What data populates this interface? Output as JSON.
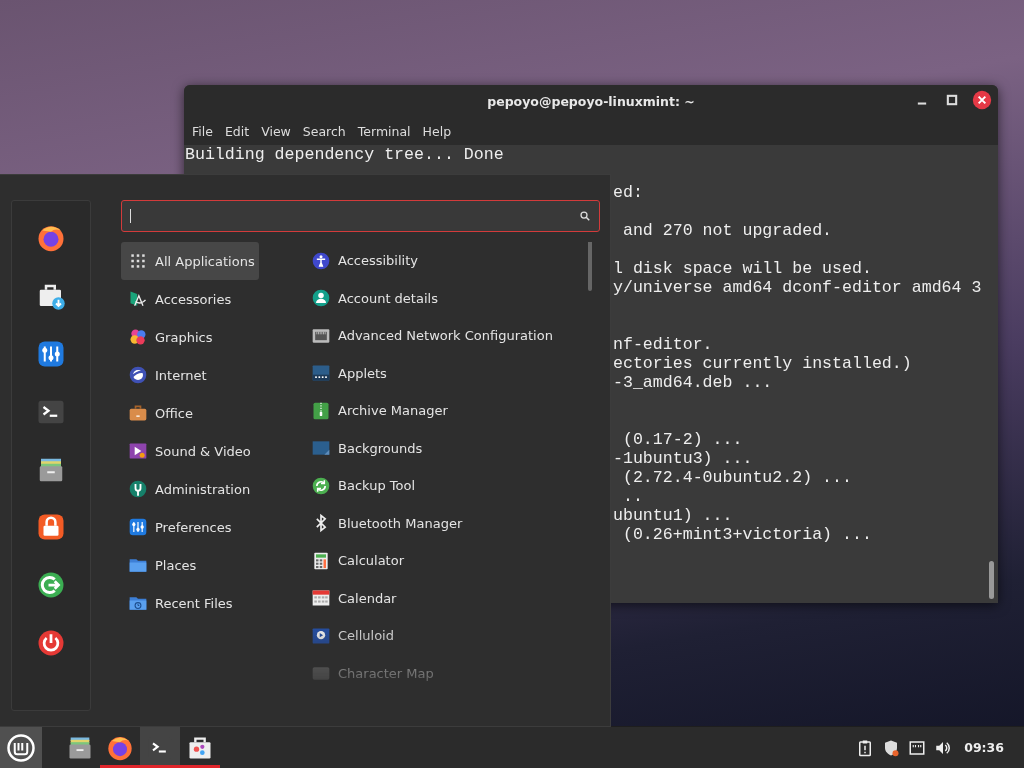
{
  "terminal": {
    "title": "pepoyo@pepoyo-linuxmint: ~",
    "menu": [
      "File",
      "Edit",
      "View",
      "Search",
      "Terminal",
      "Help"
    ],
    "lines": [
      {
        "kind": "full",
        "text": "Building dependency tree... Done"
      },
      {
        "kind": "blank"
      },
      {
        "kind": "clipped",
        "text": "ed:"
      },
      {
        "kind": "blank"
      },
      {
        "kind": "clipped",
        "text": " and 270 not upgraded."
      },
      {
        "kind": "blank"
      },
      {
        "kind": "clipped",
        "text": "l disk space will be used."
      },
      {
        "kind": "clipped",
        "text": "y/universe amd64 dconf-editor amd64 3"
      },
      {
        "kind": "blank"
      },
      {
        "kind": "blank"
      },
      {
        "kind": "clipped",
        "text": "nf-editor."
      },
      {
        "kind": "clipped",
        "text": "ectories currently installed.)"
      },
      {
        "kind": "clipped",
        "text": "-3_amd64.deb ..."
      },
      {
        "kind": "blank"
      },
      {
        "kind": "blank"
      },
      {
        "kind": "clipped",
        "text": " (0.17-2) ..."
      },
      {
        "kind": "clipped",
        "text": "-1ubuntu3) ..."
      },
      {
        "kind": "clipped",
        "text": " (2.72.4-0ubuntu2.2) ..."
      },
      {
        "kind": "clipped",
        "text": " .."
      },
      {
        "kind": "clipped",
        "text": "ubuntu1) ..."
      },
      {
        "kind": "clipped",
        "text": " (0.26+mint3+victoria) ..."
      }
    ]
  },
  "menu": {
    "categories": [
      {
        "label": "All Applications",
        "selected": true
      },
      {
        "label": "Accessories",
        "selected": false
      },
      {
        "label": "Graphics",
        "selected": false
      },
      {
        "label": "Internet",
        "selected": false
      },
      {
        "label": "Office",
        "selected": false
      },
      {
        "label": "Sound & Video",
        "selected": false
      },
      {
        "label": "Administration",
        "selected": false
      },
      {
        "label": "Preferences",
        "selected": false
      },
      {
        "label": "Places",
        "selected": false
      },
      {
        "label": "Recent Files",
        "selected": false
      }
    ],
    "apps": [
      "Accessibility",
      "Account details",
      "Advanced Network Configuration",
      "Applets",
      "Archive Manager",
      "Backgrounds",
      "Backup Tool",
      "Bluetooth Manager",
      "Calculator",
      "Calendar",
      "Celluloid",
      "Character Map"
    ]
  },
  "taskbar": {
    "apps": [
      {
        "running": false,
        "selected": false
      },
      {
        "running": true,
        "selected": false
      },
      {
        "running": true,
        "selected": true
      },
      {
        "running": true,
        "selected": false
      }
    ],
    "clock": "09:36"
  }
}
